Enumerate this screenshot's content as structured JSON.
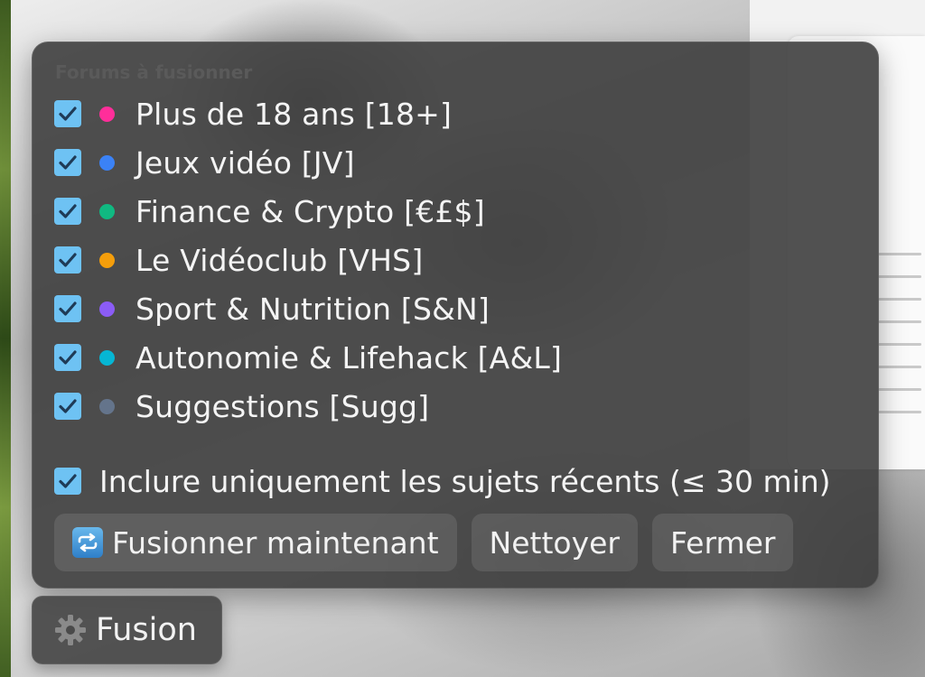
{
  "panel": {
    "title": "Forums à fusionner",
    "forums": [
      {
        "label": "Plus de 18 ans [18+]",
        "color": "#ff2e9a",
        "checked": true
      },
      {
        "label": "Jeux vidéo [JV]",
        "color": "#3b82f6",
        "checked": true
      },
      {
        "label": "Finance & Crypto [€£$]",
        "color": "#10b981",
        "checked": true
      },
      {
        "label": "Le Vidéoclub [VHS]",
        "color": "#f59e0b",
        "checked": true
      },
      {
        "label": "Sport & Nutrition [S&N]",
        "color": "#8b5cf6",
        "checked": true
      },
      {
        "label": "Autonomie & Lifehack [A&L]",
        "color": "#06b6d4",
        "checked": true
      },
      {
        "label": "Suggestions [Sugg]",
        "color": "#64748b",
        "checked": true
      }
    ],
    "recent_only": {
      "label": "Inclure uniquement les sujets récents (≤ 30 min)",
      "checked": true
    },
    "buttons": {
      "merge_label": "Fusionner maintenant",
      "clean_label": "Nettoyer",
      "close_label": "Fermer"
    },
    "checkbox_color": "#6ec2f3"
  },
  "toggle": {
    "label": "Fusion",
    "icon": "gear-icon"
  }
}
